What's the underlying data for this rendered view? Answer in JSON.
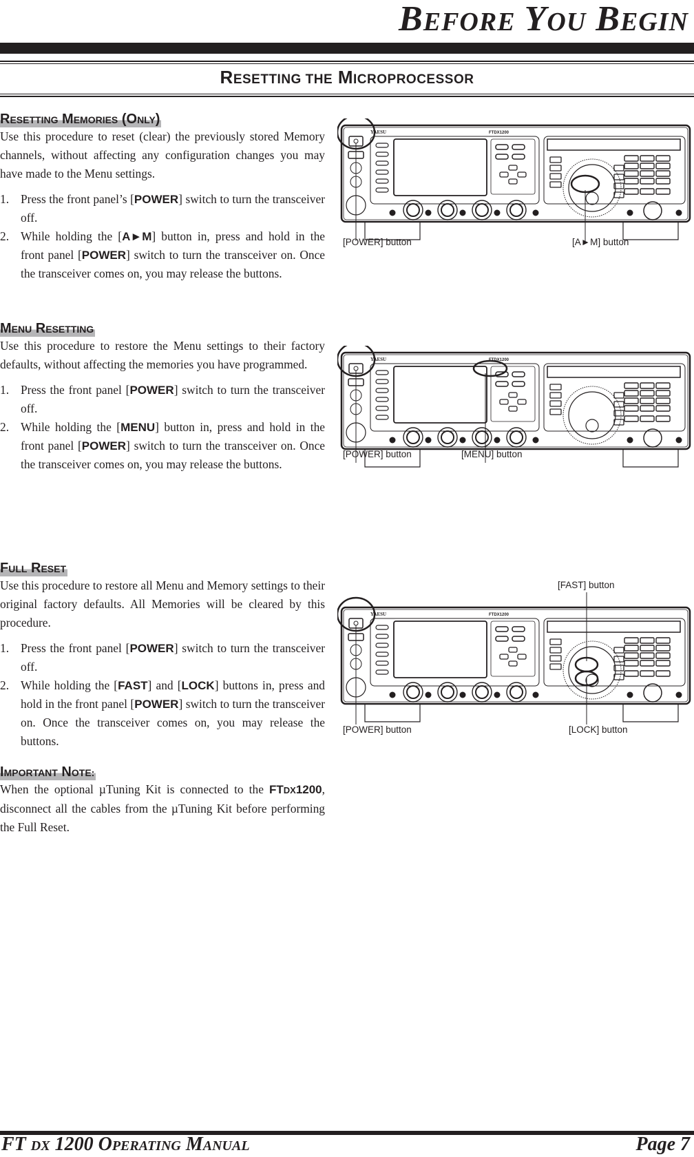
{
  "header": {
    "page_title_parts": [
      {
        "big": "B",
        "small": "EFORE"
      },
      {
        "big": "Y",
        "small": "OU"
      },
      {
        "big": "B",
        "small": "EGIN"
      }
    ],
    "section_title_parts": [
      {
        "big": "R",
        "small": "ESETTING THE"
      },
      {
        "big": "M",
        "small": "ICROPROCESSOR"
      }
    ]
  },
  "sections": [
    {
      "heading_parts": [
        {
          "big": "R",
          "small": "ESETTING"
        },
        {
          "big": "M",
          "small": "EMORIES"
        },
        {
          "big": "(O",
          "small": "NLY"
        },
        {
          "big": ")",
          "small": ""
        }
      ],
      "intro": "Use this procedure to reset (clear) the previously stored Memory channels, without affecting any configuration changes you may have made to the Menu settings.",
      "steps": [
        {
          "num": "1.",
          "pre": "Press the front panel’s [",
          "key": "POWER",
          "post": "] switch to turn the transceiver off."
        },
        {
          "num": "2.",
          "pre": "While holding the [",
          "key": "A►M",
          "mid": "] button in, press and hold in the front panel [",
          "key2": "POWER",
          "post": "] switch to turn the transceiver on. Once the transceiver comes on, you may release the buttons."
        }
      ]
    },
    {
      "heading_parts": [
        {
          "big": "M",
          "small": "ENU"
        },
        {
          "big": "R",
          "small": "ESETTING"
        }
      ],
      "intro": "Use this procedure to restore the Menu settings to their factory defaults, without affecting the memories you have programmed.",
      "steps": [
        {
          "num": "1.",
          "pre": "Press the front panel [",
          "key": "POWER",
          "post": "] switch to turn the transceiver off."
        },
        {
          "num": "2.",
          "pre": "While holding the [",
          "key": "MENU",
          "mid": "] button in, press and hold in the front panel [",
          "key2": "POWER",
          "post": "] switch to turn the transceiver on. Once the transceiver comes on, you may release the buttons."
        }
      ]
    },
    {
      "heading_parts": [
        {
          "big": "F",
          "small": "ULL"
        },
        {
          "big": "R",
          "small": "ESET"
        }
      ],
      "intro": "Use this procedure to restore all Menu and Memory settings to their original factory defaults. All Memories will be cleared by this procedure.",
      "steps": [
        {
          "num": "1.",
          "pre": "Press the front panel [",
          "key": "POWER",
          "post": "] switch to turn the transceiver off."
        },
        {
          "num": "2.",
          "pre": "While holding the [",
          "key": "FAST",
          "mid": "] and [",
          "key2": "LOCK",
          "mid2": "] buttons in, press and hold in the front panel [",
          "key3": "POWER",
          "post": "] switch to turn the transceiver on. Once the transceiver comes on, you may release the buttons."
        }
      ]
    }
  ],
  "note": {
    "heading_parts": [
      {
        "big": "I",
        "small": "MPORTANT"
      },
      {
        "big": "N",
        "small": "OTE:"
      }
    ],
    "pre": "When the optional µTuning Kit is connected to the ",
    "model_ft": "FT",
    "model_dx": "DX",
    "model_num": "1200",
    "post": ", disconnect all the cables from the µTuning Kit before performing the Full Reset."
  },
  "figures": [
    {
      "callouts": {
        "left": "[POWER] button",
        "right": "[A►M] button"
      }
    },
    {
      "callouts": {
        "left": "[POWER] button",
        "right": "[MENU] button"
      }
    },
    {
      "callouts": {
        "left": "[POWER] button",
        "top": "[FAST] button",
        "right": "[LOCK] button"
      }
    }
  ],
  "radio": {
    "brand": "YAESU",
    "model_label": "FTDX1200"
  },
  "footer": {
    "manual_ft": "FT",
    "manual_dx": "DX",
    "manual_num": "1200",
    "manual_o": "O",
    "manual_perating": "PERATING",
    "manual_m": "M",
    "manual_anual": "ANUAL",
    "page_label": "Page 7"
  }
}
